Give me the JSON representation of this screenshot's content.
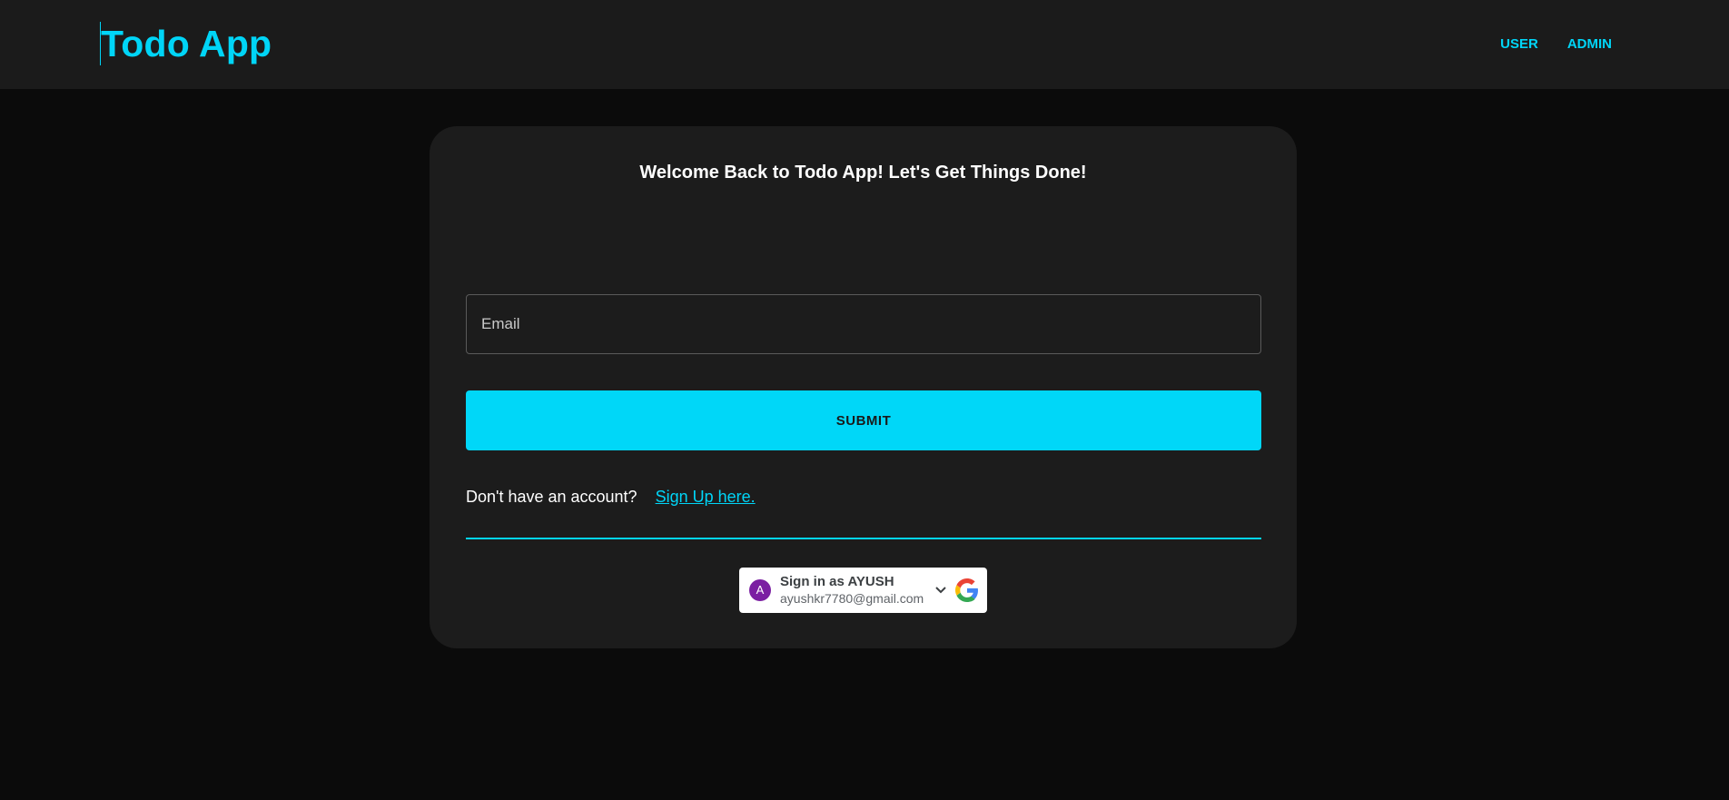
{
  "header": {
    "brand": "Todo App",
    "nav": [
      {
        "label": "USER"
      },
      {
        "label": "ADMIN"
      }
    ]
  },
  "login": {
    "welcome": "Welcome Back to Todo App! Let's Get Things Done!",
    "email_placeholder": "Email",
    "email_value": "",
    "submit_label": "SUBMIT",
    "signup_prompt": "Don't have an account?",
    "signup_link": "Sign Up here."
  },
  "google": {
    "avatar_letter": "A",
    "title": "Sign in as AYUSH",
    "email": "ayushkr7780@gmail.com",
    "icons": [
      "chevron-down-icon",
      "google-logo-icon"
    ]
  },
  "colors": {
    "accent": "#00d5f7",
    "background": "#0b0b0b",
    "card": "#1c1c1c",
    "navbar": "#1b1b1b",
    "avatar": "#7b1fa2"
  }
}
